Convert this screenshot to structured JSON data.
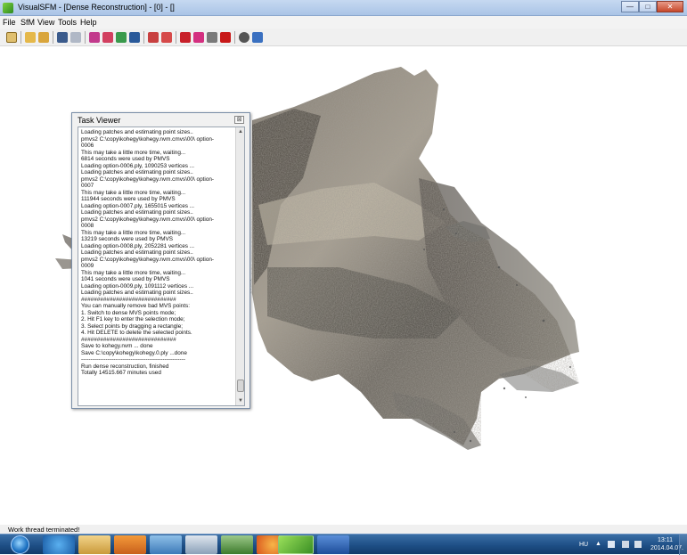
{
  "window": {
    "title": "VisualSFM - [Dense Reconstruction] - [0] - []",
    "minimize": "—",
    "maximize": "□",
    "close": "✕"
  },
  "menu": [
    "File",
    "SfM",
    "View",
    "Tools",
    "Help"
  ],
  "task_viewer": {
    "title": "Task Viewer",
    "close": "⊠",
    "log": [
      "Loading patches and estimating point sizes..",
      "pmvs2 C:\\copy\\kohegy\\kohegy.nvm.cmvs\\00\\ option-",
      "0006",
      "This may take a little more time, waiting...",
      "6814 seconds were used by PMVS",
      "Loading option-0006.ply, 1090253 vertices ...",
      "Loading patches and estimating point sizes..",
      "pmvs2 C:\\copy\\kohegy\\kohegy.nvm.cmvs\\00\\ option-",
      "0007",
      "This may take a little more time, waiting...",
      "111944 seconds were used by PMVS",
      "Loading option-0007.ply, 1655015 vertices ...",
      "Loading patches and estimating point sizes..",
      "pmvs2 C:\\copy\\kohegy\\kohegy.nvm.cmvs\\00\\ option-",
      "0008",
      "This may take a little more time, waiting...",
      "13219 seconds were used by PMVS",
      "Loading option-0008.ply, 2052281 vertices ...",
      "Loading patches and estimating point sizes..",
      "pmvs2 C:\\copy\\kohegy\\kohegy.nvm.cmvs\\00\\ option-",
      "0009",
      "This may take a little more time, waiting...",
      "1041 seconds were used by PMVS",
      "Loading option-0009.ply, 1091112 vertices ...",
      "Loading patches and estimating point sizes..",
      "##############################",
      "You can manually remove bad MVS points:",
      "1. Switch to dense MVS points mode;",
      "2. Hit F1 key to enter the selection mode;",
      "3. Select points by dragging a rectangle;",
      "4. Hit DELETE to delete the selected points.",
      "##############################",
      "Save to kohegy.nvm ... done",
      "Save C:\\copy\\kohegy\\kohegy.0.ply ...done",
      "-------------------------------------------------------",
      "Run dense reconstruction, finished",
      "Totally 14515.667 minutes used"
    ]
  },
  "status": "Work thread terminated!",
  "taskbar": {
    "language": "HU",
    "time": "13:11",
    "date": "2014.04.07."
  }
}
